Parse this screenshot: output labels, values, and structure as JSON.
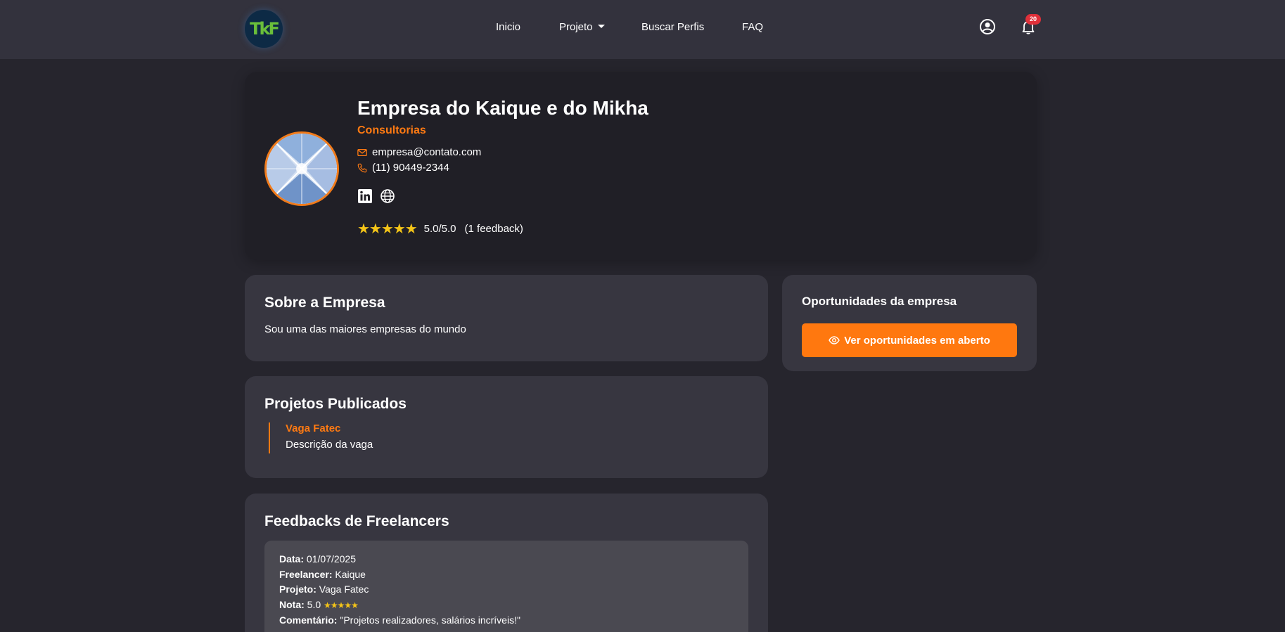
{
  "navbar": {
    "logo_text": "TkF",
    "links": [
      "Inicio",
      "Projeto",
      "Buscar Perfis",
      "FAQ"
    ],
    "notification_count": "20",
    "icons": [
      "user-circle-icon",
      "bell-icon"
    ]
  },
  "profile": {
    "name": "Empresa do Kaique e do Mikha",
    "category": "Consultorias",
    "email": "empresa@contato.com",
    "phone": "(11) 90449-2344",
    "social_icons": [
      "linkedin-icon",
      "globe-icon"
    ],
    "stars": "★★★★★",
    "rating": "5.0/5.0",
    "rating_count": "(1 feedback)"
  },
  "about": {
    "title": "Sobre a Empresa",
    "text": "Sou uma das maiores empresas do mundo"
  },
  "opportunities": {
    "title": "Oportunidades da empresa",
    "button_label": "Ver oportunidades em aberto"
  },
  "projects": {
    "title": "Projetos Publicados",
    "items": [
      {
        "title": "Vaga Fatec",
        "description": "Descrição da vaga"
      }
    ]
  },
  "feedbacks": {
    "title": "Feedbacks de Freelancers",
    "items": [
      {
        "date_label": "Data:",
        "date": "01/07/2025",
        "freelancer_label": "Freelancer:",
        "freelancer": "Kaique",
        "project_label": "Projeto:",
        "project": "Vaga Fatec",
        "grade_label": "Nota:",
        "grade": "5.0",
        "grade_stars": "★★★★★",
        "comment_label": "Comentário:",
        "comment": "\"Projetos realizadores, salários incríveis!\""
      }
    ]
  },
  "colors": {
    "accent": "#ff7a12",
    "background": "#26252d",
    "navbar": "#33323d",
    "card": "#373640",
    "star": "#f5c518",
    "badge": "#e0303a"
  }
}
